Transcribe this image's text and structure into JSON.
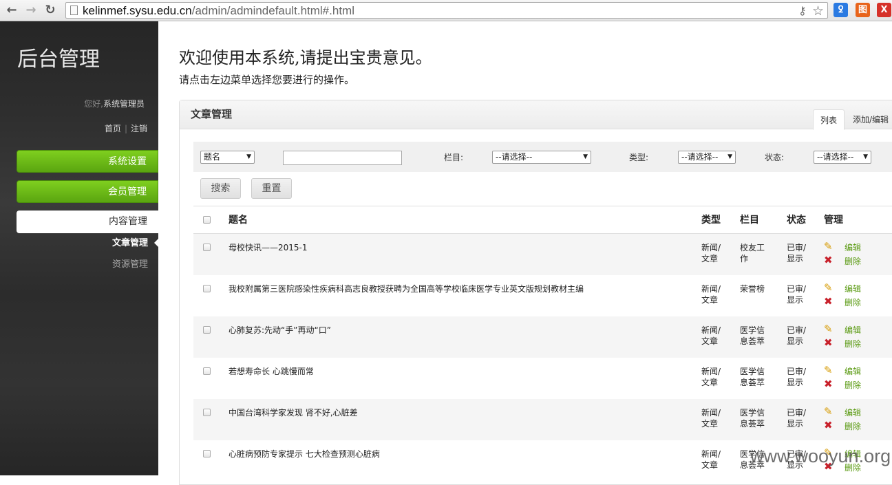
{
  "browser": {
    "url_host": "kelinmef.sysu.edu.cn",
    "url_path": "/admin/admindefault.html#.html",
    "back_glyph": "←",
    "forward_glyph": "→",
    "reload_glyph": "↻",
    "key_glyph": "⚷",
    "star_glyph": "☆",
    "ext1": "ꝿ",
    "ext2": "图",
    "ext3": "X"
  },
  "sidebar": {
    "brand": "后台管理",
    "greeting": "您好,",
    "username": "系统管理员",
    "link_home": "首页",
    "link_logout": "注销",
    "menu": [
      {
        "label": "系统设置"
      },
      {
        "label": "会员管理"
      },
      {
        "label": "内容管理"
      }
    ],
    "submenu": [
      {
        "label": "文章管理"
      },
      {
        "label": "资源管理"
      }
    ]
  },
  "main": {
    "welcome": "欢迎使用本系统,请提出宝贵意见。",
    "hint": "请点击左边菜单选择您要进行的操作。",
    "panel_title": "文章管理",
    "tabs": [
      {
        "label": "列表"
      },
      {
        "label": "添加/编辑"
      }
    ],
    "filter": {
      "field_select": "题名",
      "search_value": "",
      "column_label": "栏目:",
      "column_select": "--请选择--",
      "type_label": "类型:",
      "type_select": "--请选择--",
      "status_label": "状态:",
      "status_select": "--请选择--"
    },
    "search_button": "搜索",
    "reset_button": "重置",
    "headers": {
      "title": "题名",
      "type": "类型",
      "column": "栏目",
      "status": "状态",
      "manage": "管理"
    },
    "edit_label": "编辑",
    "delete_label": "删除",
    "edit_icon": "✎",
    "delete_icon": "✖",
    "rows": [
      {
        "title": "母校快讯——2015-1",
        "type": "新闻/文章",
        "column": "校友工作",
        "status": "已审/显示"
      },
      {
        "title": "我校附属第三医院感染性疾病科高志良教授获聘为全国高等学校临床医学专业英文版规划教材主编",
        "type": "新闻/文章",
        "column": "荣誉榜",
        "status": "已审/显示"
      },
      {
        "title": "心肺复苏:先动“手”再动“口”",
        "type": "新闻/文章",
        "column": "医学信息荟萃",
        "status": "已审/显示"
      },
      {
        "title": "若想寿命长  心跳慢而常",
        "type": "新闻/文章",
        "column": "医学信息荟萃",
        "status": "已审/显示"
      },
      {
        "title": "中国台湾科学家发现 肾不好,心脏差",
        "type": "新闻/文章",
        "column": "医学信息荟萃",
        "status": "已审/显示"
      },
      {
        "title": "心脏病预防专家提示 七大检查预测心脏病",
        "type": "新闻/文章",
        "column": "医学信息荟萃",
        "status": "已审/显示"
      }
    ]
  },
  "watermark": "www.wooyun.org"
}
